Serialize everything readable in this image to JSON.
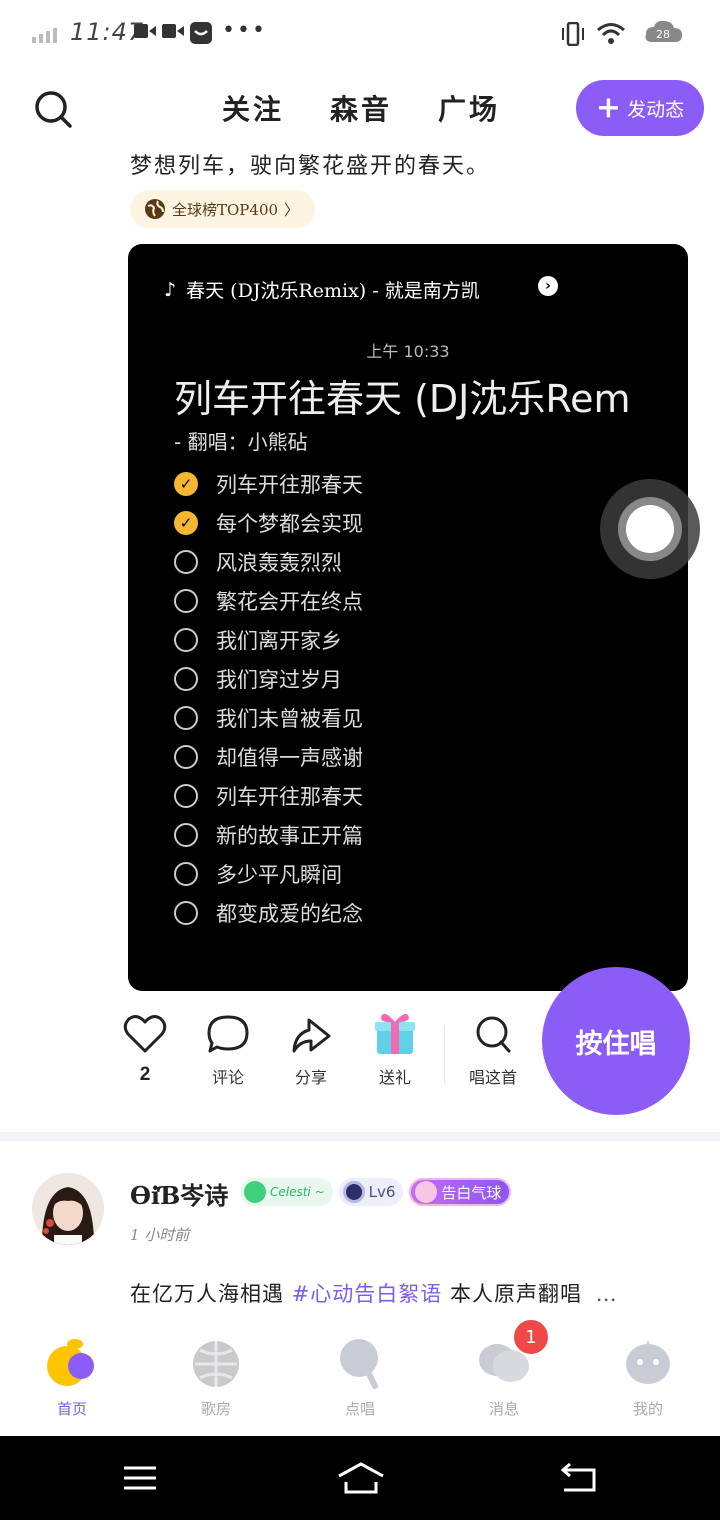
{
  "status_bar": {
    "time": "11:47",
    "battery_level": "28"
  },
  "header": {
    "tabs": [
      {
        "label": "关注",
        "active": true
      },
      {
        "label": "森音",
        "active": false
      },
      {
        "label": "广场",
        "active": false
      }
    ],
    "post_button_label": "发动态"
  },
  "post1": {
    "caption": "梦想列车，驶向繁花盛开的春天。",
    "rank_chip": "全球榜TOP400",
    "rank_chip_arrow": "〉",
    "song_line": "春天 (DJ沈乐Remix) - 就是南方凯",
    "media": {
      "time": "上午 10:33",
      "title": "列车开往春天 (DJ沈乐Rem",
      "subtitle": "-  翻唱：小熊砧",
      "checklist": [
        {
          "text": "列车开往那春天",
          "checked": true
        },
        {
          "text": "每个梦都会实现",
          "checked": true
        },
        {
          "text": "风浪轰轰烈烈",
          "checked": false
        },
        {
          "text": "繁花会开在终点",
          "checked": false
        },
        {
          "text": "我们离开家乡",
          "checked": false
        },
        {
          "text": "我们穿过岁月",
          "checked": false
        },
        {
          "text": "我们未曾被看见",
          "checked": false
        },
        {
          "text": "却值得一声感谢",
          "checked": false
        },
        {
          "text": "列车开往那春天",
          "checked": false
        },
        {
          "text": "新的故事正开篇",
          "checked": false
        },
        {
          "text": "多少平凡瞬间",
          "checked": false
        },
        {
          "text": "都变成爱的纪念",
          "checked": false
        }
      ]
    },
    "actions": {
      "like_count": "2",
      "comment": "评论",
      "share": "分享",
      "gift": "送礼",
      "sing_this": "唱这首"
    },
    "hold_sing_label": "按住唱"
  },
  "post2": {
    "username": "ƟiƁ岑诗",
    "badges": {
      "celesti": "Celesti ~",
      "level": "Lv6",
      "balloon": "告白气球"
    },
    "time": "1 小时前",
    "text_prefix": "在亿万人海相遇",
    "text_tag": "#心动告白絮语",
    "text_suffix": "本人原声翻唱",
    "text_more": "…"
  },
  "bottom_nav": {
    "items": [
      {
        "label": "首页",
        "active": true
      },
      {
        "label": "歌房",
        "active": false
      },
      {
        "label": "点唱",
        "active": false
      },
      {
        "label": "消息",
        "active": false
      },
      {
        "label": "我的",
        "active": false
      }
    ],
    "message_badge": "1"
  },
  "colors": {
    "accent": "#8b5cf6",
    "tab_highlight": "#ffd400",
    "check_on": "#f5b731",
    "badge_red": "#f04848"
  }
}
